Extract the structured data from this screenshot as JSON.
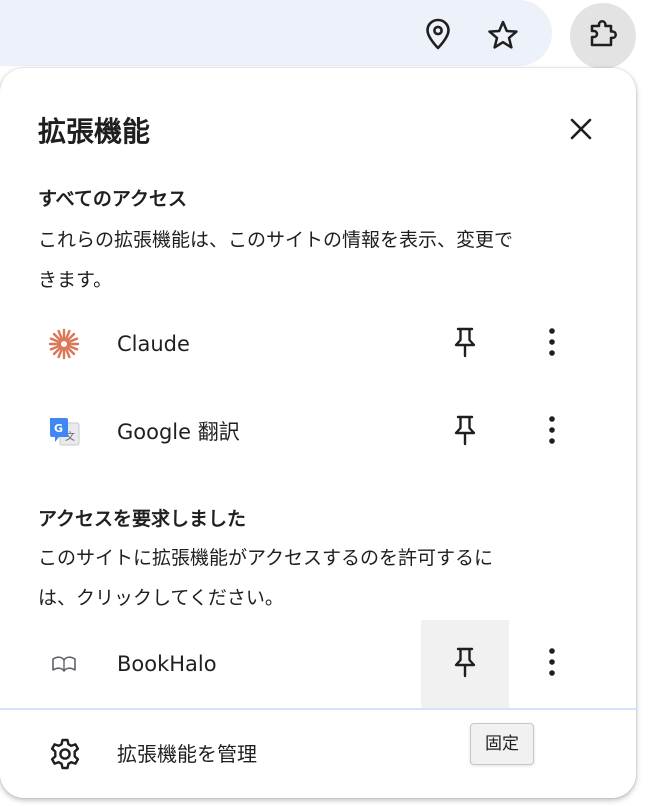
{
  "toolbar": {
    "icons": [
      "location-pin-icon",
      "star-icon",
      "puzzle-extensions-icon"
    ]
  },
  "popup": {
    "title": "拡張機能",
    "close_icon": "close-icon"
  },
  "full_access": {
    "heading": "すべてのアクセス",
    "description_lines": [
      "これらの拡張機能は、このサイトの情報を表示、変更で",
      "きます。"
    ],
    "extensions": [
      {
        "name": "Claude",
        "icon": "claude-logo-icon"
      },
      {
        "name": "Google 翻訳",
        "icon": "google-translate-icon"
      }
    ]
  },
  "requested_access": {
    "heading": "アクセスを要求しました",
    "description_lines": [
      "このサイトに拡張機能がアクセスするのを許可するに",
      "は、クリックしてください。"
    ],
    "extensions": [
      {
        "name": "BookHalo",
        "icon": "book-icon"
      }
    ]
  },
  "footer": {
    "manage_label": "拡張機能を管理",
    "manage_icon": "gear-icon"
  },
  "tooltip": {
    "text": "固定"
  },
  "colors": {
    "omnibox_bg": "#edf1f9",
    "claude_accent": "#d97757",
    "google_blue": "#4285f4",
    "divider": "#d3e3fd"
  }
}
